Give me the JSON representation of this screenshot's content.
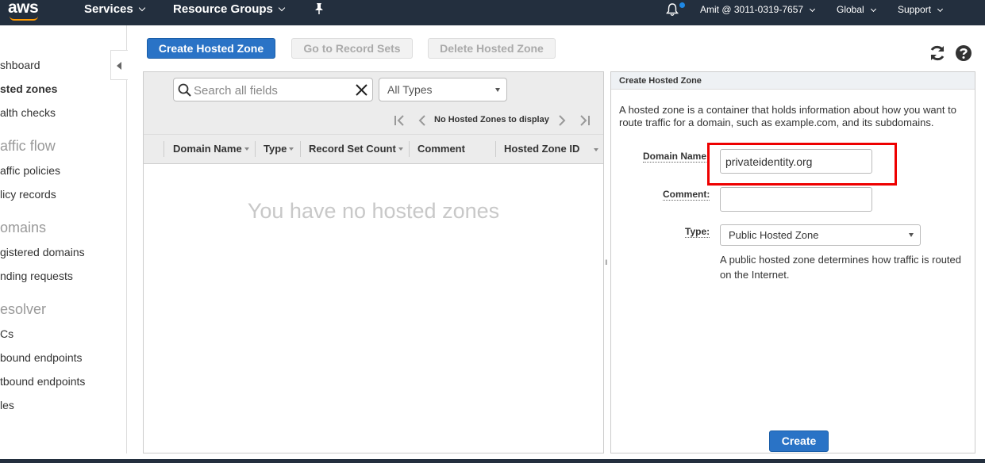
{
  "topnav": {
    "logo": "aws",
    "services": "Services",
    "resource_groups": "Resource Groups",
    "account": "Amit @ 3011-0319-7657",
    "region": "Global",
    "support": "Support"
  },
  "sidebar": {
    "items": [
      {
        "label": "shboard"
      },
      {
        "label": "sted zones"
      },
      {
        "label": "alth checks"
      }
    ],
    "section_traffic_flow": "affic flow",
    "traffic_items": [
      {
        "label": "affic policies"
      },
      {
        "label": "licy records"
      }
    ],
    "section_domains": "omains",
    "domain_items": [
      {
        "label": "gistered domains"
      },
      {
        "label": "nding requests"
      }
    ],
    "section_resolver": "esolver",
    "resolver_items": [
      {
        "label": "Cs"
      },
      {
        "label": "bound endpoints"
      },
      {
        "label": "tbound endpoints"
      },
      {
        "label": "les"
      }
    ]
  },
  "toolbar": {
    "create_hosted_zone": "Create Hosted Zone",
    "go_to_record_sets": "Go to Record Sets",
    "delete_hosted_zone": "Delete Hosted Zone"
  },
  "list": {
    "search_placeholder": "Search all fields",
    "type_filter": "All Types",
    "pagination_label": "No Hosted Zones to display",
    "columns": [
      "Domain Name",
      "Type",
      "Record Set Count",
      "Comment",
      "Hosted Zone ID"
    ],
    "empty_message": "You have no hosted zones"
  },
  "detail": {
    "title": "Create Hosted Zone",
    "description": "A hosted zone is a container that holds information about how you want to route traffic for a domain, such as example.com, and its subdomains.",
    "domain_name_label": "Domain Name",
    "domain_name_value": "privateidentity.org",
    "comment_label": "Comment:",
    "comment_value": "",
    "type_label": "Type:",
    "type_value": "Public Hosted Zone",
    "type_description": "A public hosted zone determines how traffic is routed on the Internet.",
    "create_button": "Create"
  },
  "colors": {
    "nav_bg": "#232f3e",
    "primary": "#2a73c6",
    "highlight": "#e00000",
    "brand_orange": "#ff9900"
  }
}
